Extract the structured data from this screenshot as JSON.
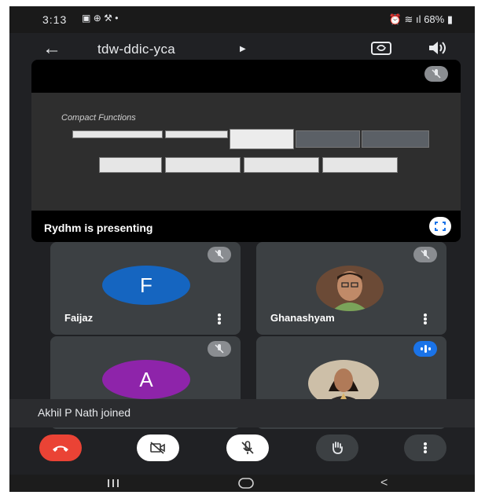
{
  "status": {
    "time": "3:13",
    "battery": "68%"
  },
  "meeting": {
    "code": "tdw-ddic-yca"
  },
  "presentation": {
    "label": "Rydhm  is presenting",
    "slide_title": "Compact Functions"
  },
  "participants": [
    {
      "name": "Faijaz",
      "initial": "F",
      "avatar_color": "#1565c0",
      "muted": true
    },
    {
      "name": "Ghanashyam",
      "initial": "",
      "muted": true
    },
    {
      "name": "",
      "initial": "A",
      "avatar_color": "#8e24aa",
      "muted": true
    },
    {
      "name": "",
      "initial": "",
      "speaking": true
    }
  ],
  "toast": "Akhil P Nath joined",
  "colors": {
    "end_call": "#ea4335",
    "accent": "#1a73e8",
    "tile_bg": "#3c4043",
    "background": "#202124"
  },
  "icons": [
    "back-arrow-icon",
    "camera-switch-icon",
    "speaker-icon",
    "mic-off-icon",
    "fullscreen-icon",
    "more-vert-icon",
    "end-call-icon",
    "camera-off-icon",
    "raise-hand-icon"
  ]
}
